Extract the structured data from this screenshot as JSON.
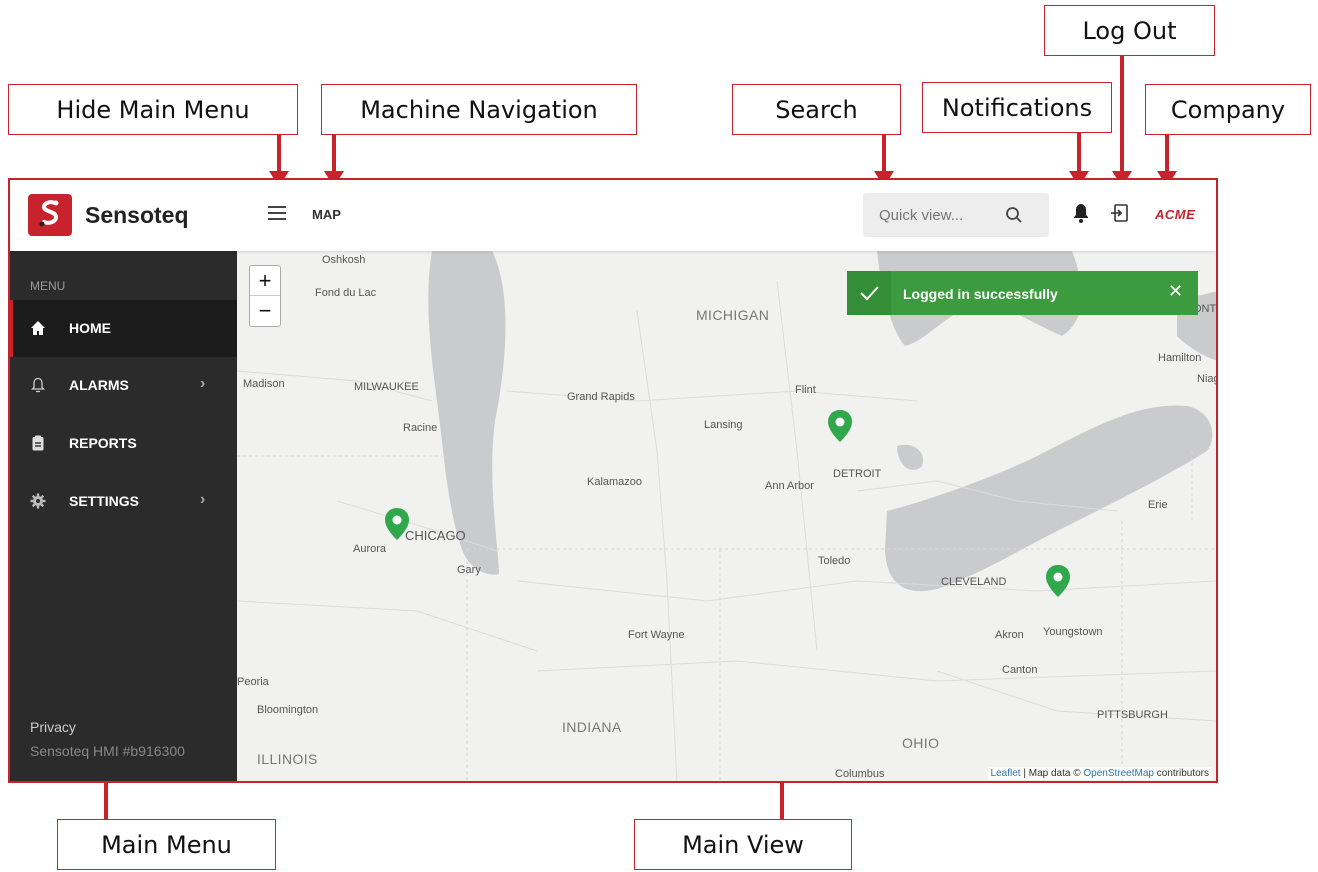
{
  "callouts": {
    "hide_main_menu": "Hide Main Menu",
    "machine_navigation": "Machine Navigation",
    "search": "Search",
    "notifications": "Notifications",
    "log_out": "Log Out",
    "company": "Company",
    "main_menu": "Main Menu",
    "main_view": "Main View"
  },
  "app": {
    "brand": "Sensoteq",
    "nav_title": "MAP",
    "search_placeholder": "Quick view...",
    "company": "ACME"
  },
  "sidebar": {
    "menu_label": "MENU",
    "items": [
      {
        "label": "HOME",
        "icon": "home-icon",
        "active": true
      },
      {
        "label": "ALARMS",
        "icon": "bell-outline-icon"
      },
      {
        "label": "REPORTS",
        "icon": "clipboard-icon"
      },
      {
        "label": "SETTINGS",
        "icon": "gear-icon"
      }
    ],
    "privacy": "Privacy",
    "version": "Sensoteq HMI #b916300"
  },
  "toast": {
    "message": "Logged in successfully"
  },
  "map": {
    "states": [
      "MICHIGAN",
      "INDIANA",
      "ILLINOIS",
      "OHIO"
    ],
    "cities": [
      "Oshkosh",
      "Fond du Lac",
      "Madison",
      "MILWAUKEE",
      "Racine",
      "Grand Rapids",
      "Lansing",
      "Flint",
      "Kalamazoo",
      "Ann Arbor",
      "DETROIT",
      "Hamilton",
      "Niag",
      "Erie",
      "CHICAGO",
      "Aurora",
      "Gary",
      "Toledo",
      "CLEVELAND",
      "Fort Wayne",
      "Akron",
      "Youngstown",
      "Canton",
      "Peoria",
      "Bloomington",
      "PITTSBURGH",
      "Columbus",
      "ONT"
    ],
    "zoom_in": "+",
    "zoom_out": "−",
    "attribution_leaflet": "Leaflet",
    "attribution_text": " | Map data © ",
    "attribution_osm": "OpenStreetMap",
    "attribution_tail": " contributors"
  },
  "colors": {
    "accent": "#c8232c",
    "success": "#3c9a3f",
    "sidebar": "#2b2b2b"
  }
}
